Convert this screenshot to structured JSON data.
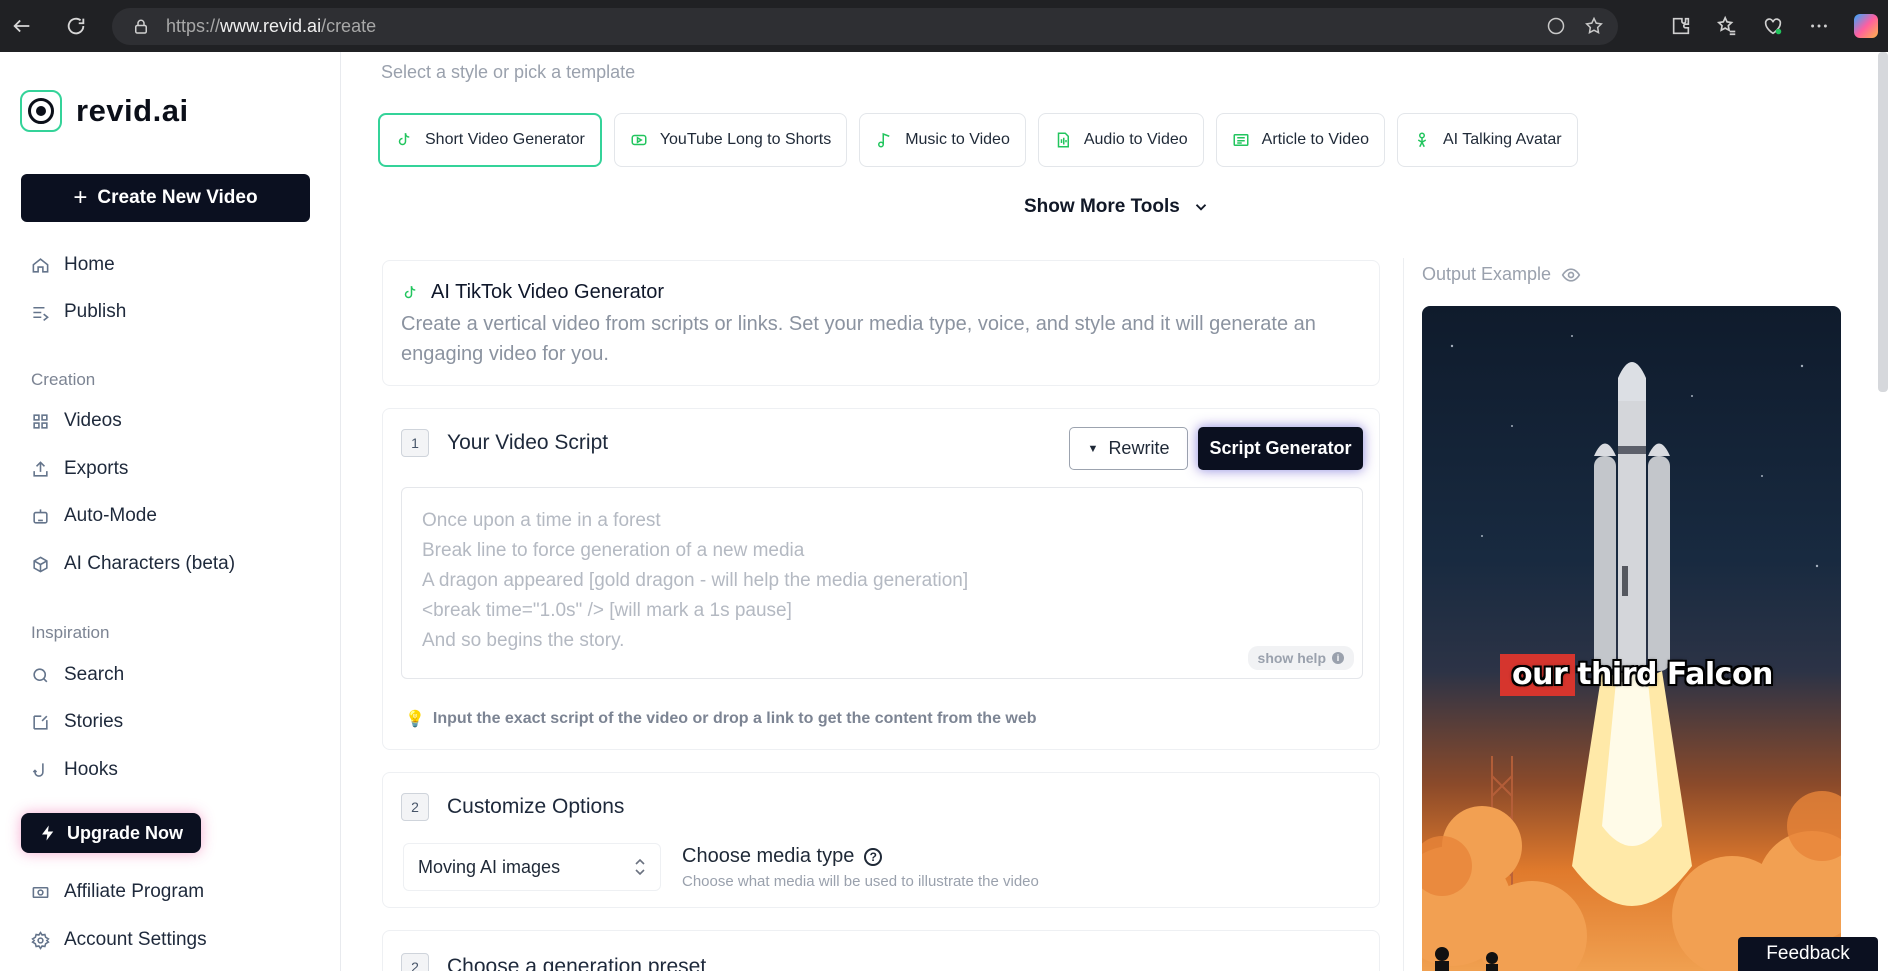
{
  "browser": {
    "url_protocol": "https://",
    "url_host": "www.revid.ai",
    "url_path": "/create"
  },
  "sidebar": {
    "logo_text": "revid.ai",
    "create_button": "Create New Video",
    "main_items": [
      {
        "label": "Home",
        "icon": "home-icon"
      },
      {
        "label": "Publish",
        "icon": "publish-icon"
      }
    ],
    "creation_section": "Creation",
    "creation_items": [
      {
        "label": "Videos",
        "icon": "grid-icon"
      },
      {
        "label": "Exports",
        "icon": "export-icon"
      },
      {
        "label": "Auto-Mode",
        "icon": "robot-icon"
      },
      {
        "label": "AI Characters (beta)",
        "icon": "cube-icon"
      }
    ],
    "inspiration_section": "Inspiration",
    "inspiration_items": [
      {
        "label": "Search",
        "icon": "search-icon"
      },
      {
        "label": "Stories",
        "icon": "edit-icon"
      },
      {
        "label": "Hooks",
        "icon": "hook-icon"
      }
    ],
    "upgrade_button": "Upgrade Now",
    "bottom_items": [
      {
        "label": "Affiliate Program",
        "icon": "money-icon"
      },
      {
        "label": "Account Settings",
        "icon": "gear-icon"
      }
    ]
  },
  "main": {
    "select_prompt": "Select a style or pick a template",
    "tools": [
      {
        "label": "Short Video Generator",
        "icon": "tiktok-icon",
        "active": true
      },
      {
        "label": "YouTube Long to Shorts",
        "icon": "youtube-icon",
        "active": false
      },
      {
        "label": "Music to Video",
        "icon": "music-icon",
        "active": false
      },
      {
        "label": "Audio to Video",
        "icon": "audio-file-icon",
        "active": false
      },
      {
        "label": "Article to Video",
        "icon": "article-icon",
        "active": false
      },
      {
        "label": "AI Talking Avatar",
        "icon": "avatar-icon",
        "active": false
      }
    ],
    "show_more": "Show More Tools",
    "generator_title": "AI TikTok Video Generator",
    "generator_description": "Create a vertical video from scripts or links. Set your media type, voice, and style and it will generate an engaging video for you.",
    "script_step": {
      "number": "1",
      "title": "Your Video Script",
      "rewrite_button": "Rewrite",
      "script_generator_button": "Script Generator",
      "placeholder_lines": [
        "Once upon a time in a forest",
        "Break line to force generation of a new media",
        "A dragon appeared  [gold dragon - will help the media generation]",
        "<break time=\"1.0s\" />  [will mark a 1s pause]",
        "And so begins the story."
      ],
      "show_help": "show help",
      "hint": "Input the exact script of the video or drop a link to get the content from the web"
    },
    "customize_step": {
      "number": "2",
      "title": "Customize Options",
      "media_select_value": "Moving AI images",
      "media_label": "Choose media type",
      "media_sub": "Choose what media will be used to illustrate the video"
    },
    "preset_step": {
      "number": "2",
      "title": "Choose a generation preset"
    }
  },
  "output": {
    "label": "Output Example",
    "caption": "our third Falcon"
  },
  "feedback_button": "Feedback",
  "colors": {
    "accent_green": "#34d399",
    "dark_button": "#0b1020",
    "muted_text": "#9aa1ad"
  }
}
